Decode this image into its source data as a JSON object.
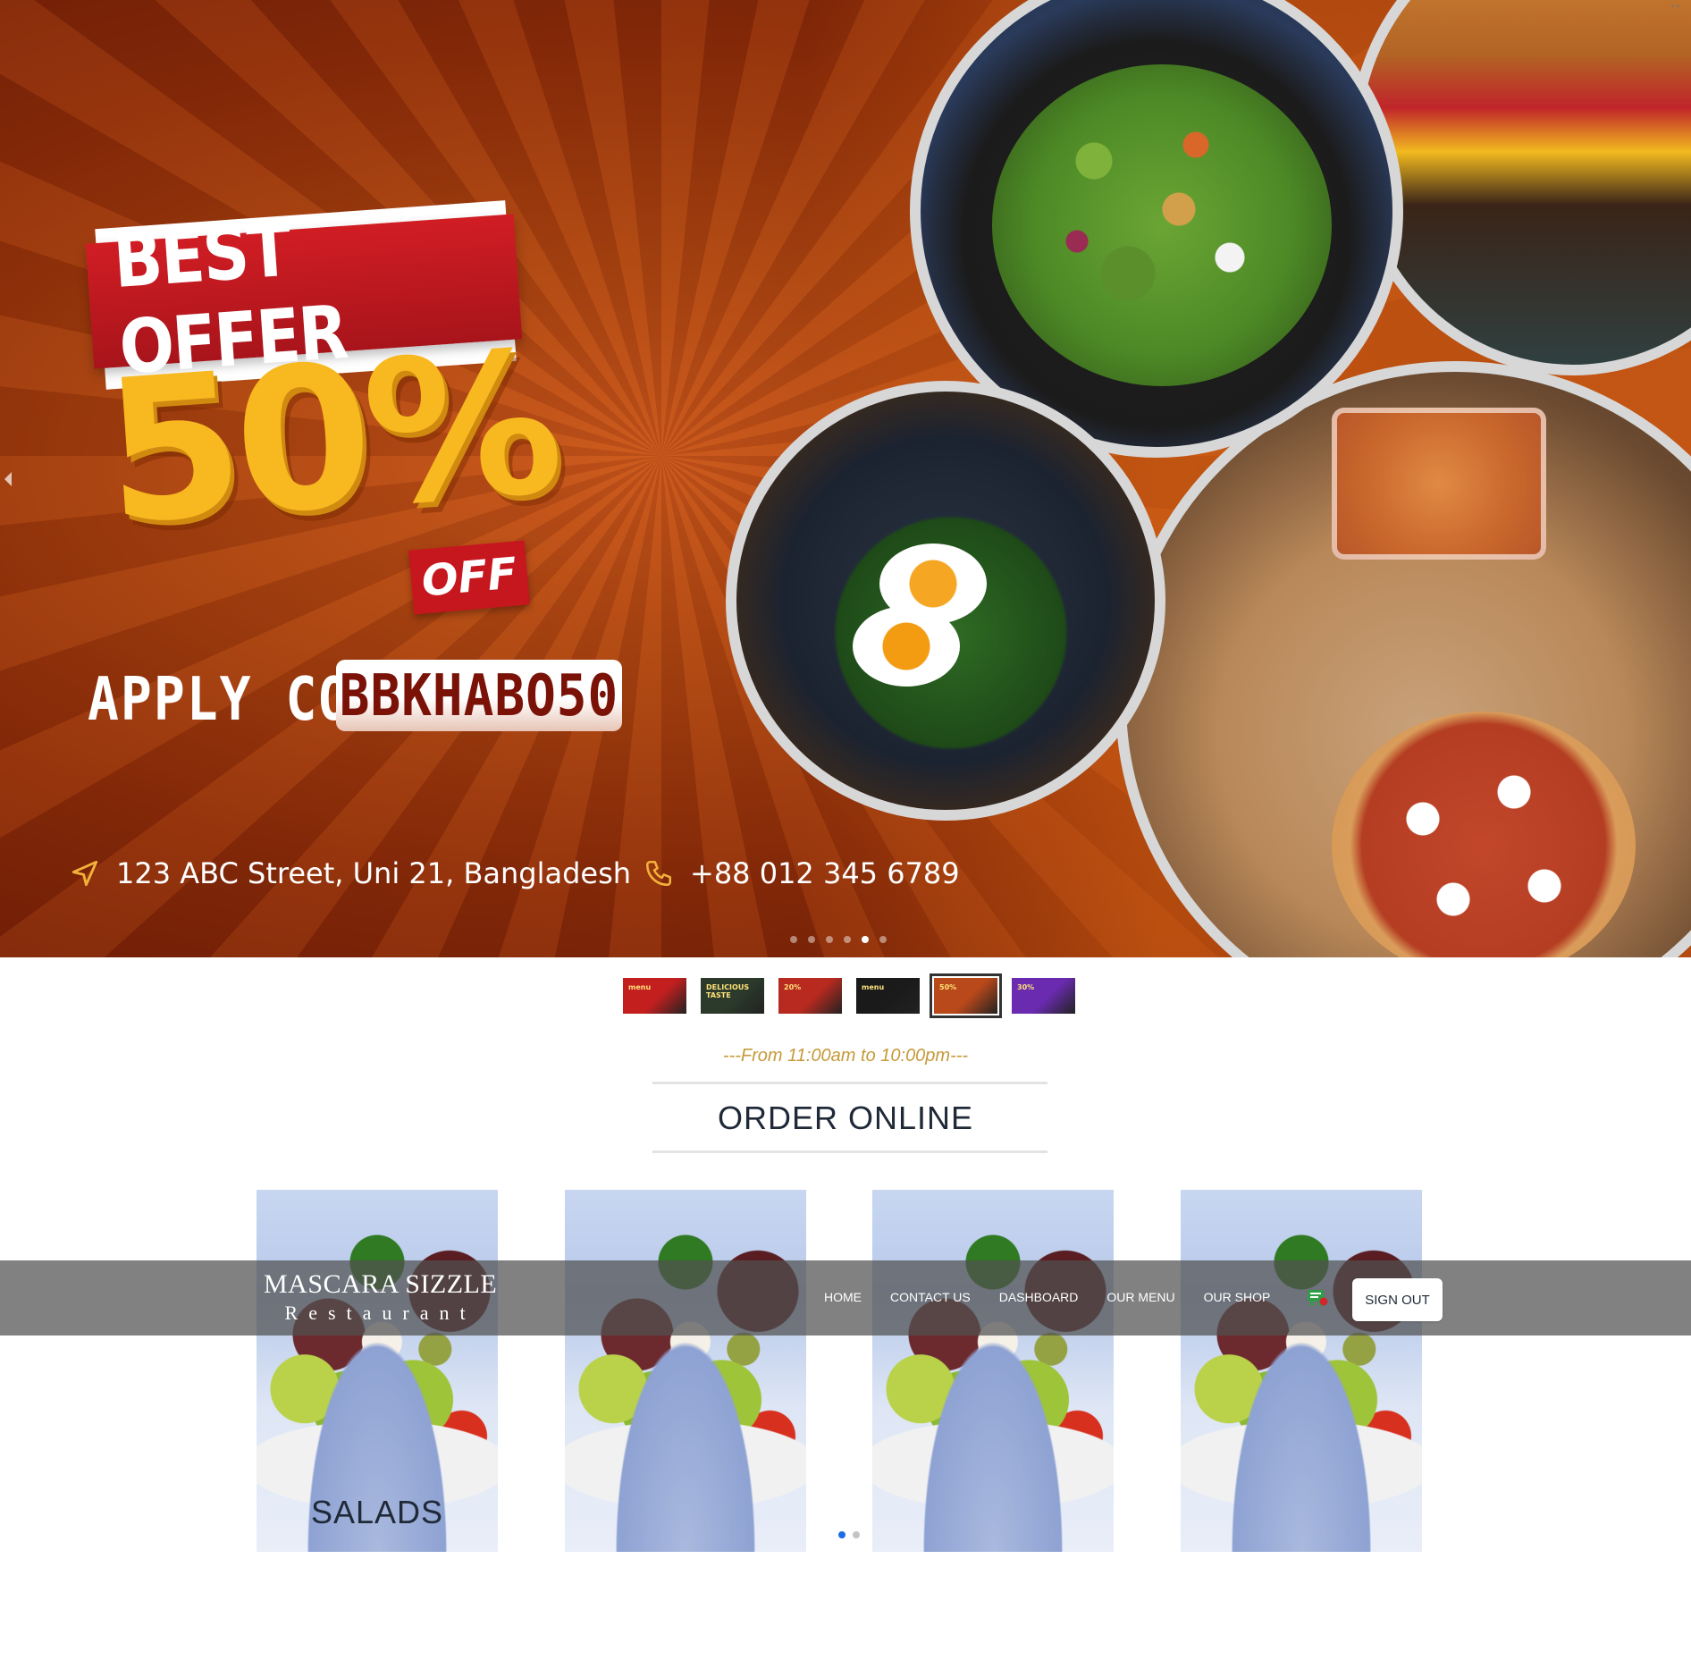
{
  "hero": {
    "headline": "BEST OFFER",
    "discount": "50%",
    "off_label": "OFF",
    "apply_code_label": "APPLY CODE",
    "promo_code": "BBKHABO50",
    "address": "123 ABC Street, Uni 21, Bangladesh",
    "phone": "+88 012 345 6789",
    "active_slide": 5,
    "slide_count": 6
  },
  "thumbnails": [
    {
      "label": "menu",
      "color": "#c31f1f",
      "active": false
    },
    {
      "label": "DELICIOUS TASTE",
      "color": "#2b3a2b",
      "active": false
    },
    {
      "label": "20%",
      "color": "#b82a1f",
      "active": false
    },
    {
      "label": "menu",
      "color": "#1a1a1a",
      "active": false
    },
    {
      "label": "50%",
      "color": "#b9481a",
      "active": true
    },
    {
      "label": "30%",
      "color": "#6a2bb0",
      "active": false
    }
  ],
  "section": {
    "hours": "---From 11:00am to 10:00pm---",
    "title": "ORDER ONLINE"
  },
  "cards": [
    {
      "label": "SALADS"
    },
    {
      "label": ""
    },
    {
      "label": ""
    },
    {
      "label": ""
    }
  ],
  "cards_carousel": {
    "active_page": 1,
    "page_count": 2
  },
  "navbar": {
    "brand_name": "MASCARA SIZZLE",
    "brand_sub": "Restaurant",
    "links": [
      "HOME",
      "CONTACT US",
      "DASHBOARD",
      "OUR MENU",
      "OUR SHOP"
    ],
    "signout_label": "SIGN OUT",
    "cart_icon": "cart-icon"
  },
  "colors": {
    "brand_red": "#c6161e",
    "offer_gold": "#f8b820",
    "hours_gold": "#c59a3a",
    "heading_text": "#1f2937",
    "active_dot_blue": "#1d6de5"
  }
}
